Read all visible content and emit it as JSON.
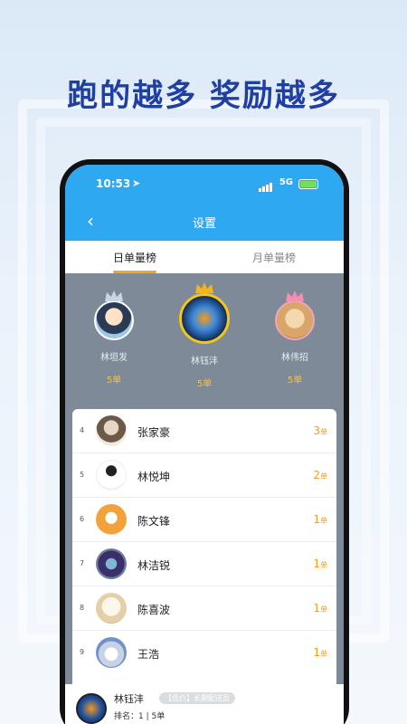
{
  "headline": "跑的越多 奖励越多",
  "status_bar": {
    "time": "10:53",
    "network": "5G"
  },
  "navbar": {
    "back_icon": "chevron-left-icon",
    "title": "设置"
  },
  "tabs": [
    {
      "label": "日单量榜",
      "active": true
    },
    {
      "label": "月单量榜",
      "active": false
    }
  ],
  "podium": [
    {
      "position": 2,
      "name": "林垣发",
      "count": "5单"
    },
    {
      "position": 1,
      "name": "林钰沣",
      "count": "5单"
    },
    {
      "position": 3,
      "name": "林伟招",
      "count": "5单"
    }
  ],
  "ranking": [
    {
      "rank": "4",
      "name": "张家豪",
      "count": "3",
      "unit": "单"
    },
    {
      "rank": "5",
      "name": "林悦坤",
      "count": "2",
      "unit": "单"
    },
    {
      "rank": "6",
      "name": "陈文锋",
      "count": "1",
      "unit": "单"
    },
    {
      "rank": "7",
      "name": "林洁锐",
      "count": "1",
      "unit": "单"
    },
    {
      "rank": "8",
      "name": "陈喜波",
      "count": "1",
      "unit": "单"
    },
    {
      "rank": "9",
      "name": "王浩",
      "count": "1",
      "unit": "单"
    }
  ],
  "me": {
    "name": "林钰沣",
    "tag": "【低价】长期配送员",
    "rank_text": "排名：1 | 5单"
  },
  "colors": {
    "brand": "#2ea8f0",
    "accent": "#f5a623",
    "headline": "#1f3fa3"
  }
}
